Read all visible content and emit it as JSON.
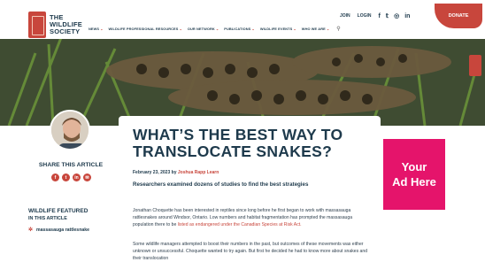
{
  "brand": {
    "line1": "THE",
    "line2": "WILDLIFE",
    "line3": "SOCIETY"
  },
  "nav": {
    "items": [
      "NEWS",
      "WILDLIFE PROFESSIONAL RESOURCES",
      "OUR NETWORK",
      "PUBLICATIONS",
      "WILDLIFE EVENTS",
      "WHO WE ARE"
    ]
  },
  "util": {
    "join": "JOIN",
    "login": "LOGIN",
    "donate": "DONATE"
  },
  "social_top": [
    "facebook-icon",
    "twitter-icon",
    "instagram-icon",
    "linkedin-icon"
  ],
  "sidebar": {
    "share_title": "SHARE THIS ARTICLE",
    "share_icons": [
      "facebook-icon",
      "twitter-icon",
      "linkedin-icon",
      "email-icon"
    ],
    "featured_title": "WILDLIFE FEATURED",
    "featured_sub": "IN THIS ARTICLE",
    "featured_item": "massasauga rattlesnake"
  },
  "article": {
    "title_line1": "WHAT’S THE BEST WAY TO",
    "title_line2": "TRANSLOCATE SNAKES?",
    "date": "February 23, 2023 by",
    "author": "Joshua Rapp Learn",
    "subhead": "Researchers examined dozens of studies to find the best strategies",
    "p1_a": "Jonathan Choquette has been interested in reptiles since long before he first began to work with massasauga rattlesnakes around Windsor, Ontario. Low numbers and habitat fragmentation has prompted the massasauga population there to be",
    "p1_link": "listed as endangered under the Canadian Species at Risk Act.",
    "p2": "Some wildlife managers attempted to boost their numbers in the past, but outcomes of these movements was either unknown or unsuccessful. Choquette wanted to try again. But first he decided he had to know more about snakes and their translocation"
  },
  "ad": {
    "line1": "Your",
    "line2": "Ad Here"
  },
  "colors": {
    "brand_red": "#c8463c",
    "navy": "#1e3a4c",
    "ad_pink": "#e5146b"
  }
}
